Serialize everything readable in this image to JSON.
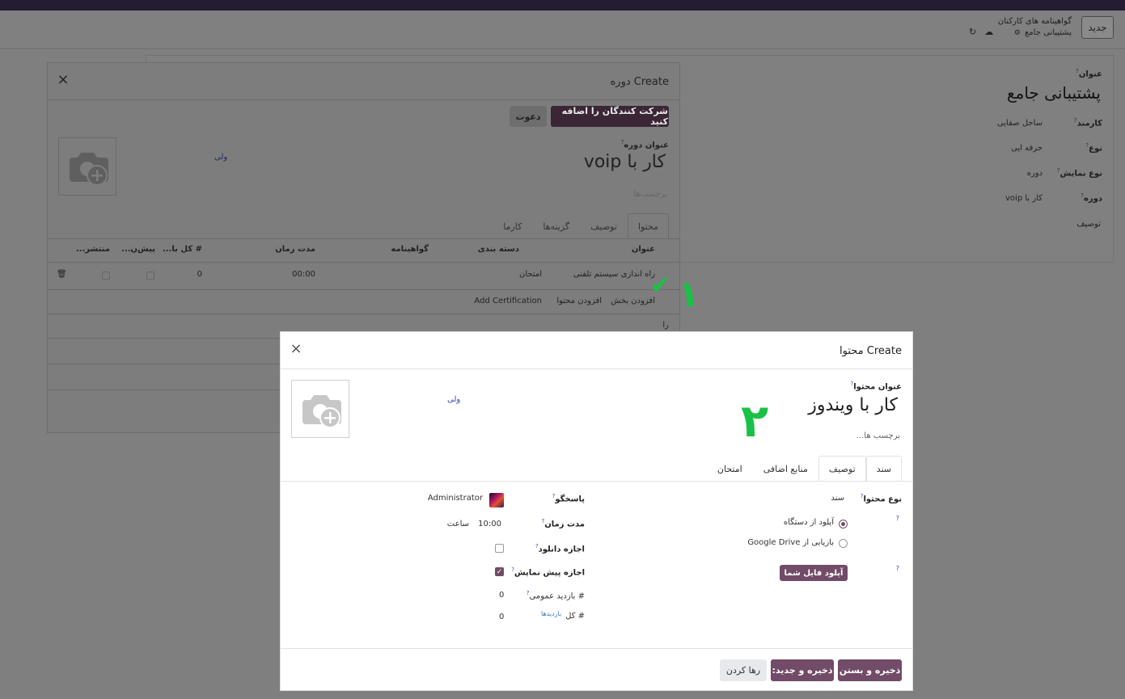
{
  "control_panel": {
    "new_label": "جدید",
    "breadcrumb_parent": "گواهینامه های کارکنان",
    "breadcrumb_current": "پشتیبانی جامع"
  },
  "background_form": {
    "title_label": "عنوان",
    "title_value": "پشتیبانی جامع",
    "employee_label": "کارمند",
    "employee_value": "ساحل صفایی",
    "type_label": "نوع",
    "type_value": "حرفه ایی",
    "display_type_label": "نوع نمایش",
    "display_type_value": "دوره",
    "course_label": "دوره",
    "course_value": "کار با voip",
    "description_label": "توصیف"
  },
  "course_dialog": {
    "title": "Create دوره",
    "add_attendees_label": "شرکت کنندگان را اضافه کنید",
    "invite_label": "دعوت",
    "course_title_label": "عنوان دوره",
    "course_title_value": "کار با voip",
    "tags_placeholder": "برچسب‌ها",
    "side_link": "ولی",
    "tabs": [
      "محتوا",
      "توصیف",
      "گزینه‌ها",
      "کارما"
    ],
    "columns": {
      "title": "عنوان",
      "category": "دسته بندی",
      "certificate": "گواهینامه",
      "duration": "مدت زمان",
      "total": "# کل با...",
      "preview": "پیش‌ن...",
      "published": "منتشر..."
    },
    "row": {
      "title": "راه اندازی سیستم تلفنی",
      "category": "امتحان",
      "duration": "00:00",
      "total": "0"
    },
    "add_section": "افزودن بخش",
    "add_content": "افزودن محتوا",
    "add_certification": "Add Certification",
    "extra_row_text": "را"
  },
  "content_dialog": {
    "title": "Create محتوا",
    "content_title_label": "عنوان محتوا",
    "content_title_value": "کار با ویندوز",
    "tags_placeholder": "برچسب ها...",
    "side_link": "ولی",
    "tabs": [
      "سند",
      "توصیف",
      "منابع اضافی",
      "امتحان"
    ],
    "content_type_label": "نوع محتوا",
    "content_type_value": "سند",
    "upload_from_device": "آپلود از دستگاه",
    "retrieve_from_drive": "بازیابی از Google Drive",
    "upload_button": "آپلود فایل شما",
    "responsible_label": "پاسخگو",
    "responsible_value": "Administrator",
    "duration_label": "مدت زمان",
    "duration_value": "10:00",
    "duration_unit": "ساعت",
    "allow_download_label": "اجازه دانلود",
    "allow_download": false,
    "allow_preview_label": "اجازه پیش نمایش",
    "allow_preview": true,
    "public_views_label": "# بازدید عمومی",
    "public_views_value": "0",
    "total_label": "# کل",
    "views_link": "بازدیدها",
    "total_value": "0",
    "save_close": "ذخیره و بستن",
    "save_new": "ذخیره و جدید:",
    "discard": "رها کردن"
  },
  "annotations": {
    "one": "١",
    "two": "٢"
  },
  "colors": {
    "primary": "#714b67",
    "annotation": "#19c146"
  }
}
